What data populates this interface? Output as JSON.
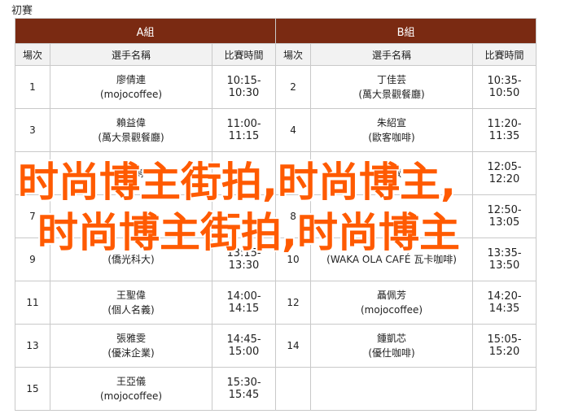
{
  "page_title": "初賽",
  "groups": {
    "a": "A組",
    "b": "B組"
  },
  "columns": {
    "seed": "場次",
    "player": "選手名稱",
    "time": "比賽時間"
  },
  "rows": [
    {
      "a": {
        "seed": "1",
        "name": "廖倩連",
        "team": "(mojocoffee)",
        "time": "10:15-10:30"
      },
      "b": {
        "seed": "2",
        "name": "丁佳芸",
        "team": "(萬大景觀餐廳)",
        "time": "10:35-10:50"
      }
    },
    {
      "a": {
        "seed": "3",
        "name": "賴益偉",
        "team": "(萬大景觀餐廳)",
        "time": "11:00-11:15"
      },
      "b": {
        "seed": "4",
        "name": "朱紹宣",
        "team": "(歐客咖啡)",
        "time": "11:20-11:35"
      }
    },
    {
      "a": {
        "seed": "5",
        "name": "許鈺婷",
        "team": "",
        "time": ""
      },
      "b": {
        "seed": "6",
        "name": "劉淑",
        "team": "",
        "time": "12:05-12:20"
      }
    },
    {
      "a": {
        "seed": "7",
        "name": "",
        "team": "",
        "time": ""
      },
      "b": {
        "seed": "8",
        "name": "",
        "team": "",
        "time": "12:50-13:05"
      }
    },
    {
      "a": {
        "seed": "9",
        "name": "",
        "team": "(僑光科大)",
        "time": "13:15-13:30"
      },
      "b": {
        "seed": "10",
        "name": "",
        "team": "(WAKA OLA CAFÉ 瓦卡咖啡)",
        "time": "13:35-13:50"
      }
    },
    {
      "a": {
        "seed": "11",
        "name": "王聖偉",
        "team": "(個人名義)",
        "time": "14:00-14:15"
      },
      "b": {
        "seed": "12",
        "name": "聶佩芳",
        "team": "(mojocoffee)",
        "time": "14:20-14:35"
      }
    },
    {
      "a": {
        "seed": "13",
        "name": "張雅雯",
        "team": "(優沫企業)",
        "time": "14:45-15:00"
      },
      "b": {
        "seed": "14",
        "name": "鍾凱芯",
        "team": "(優仕咖啡)",
        "time": "15:05-15:20"
      }
    },
    {
      "a": {
        "seed": "15",
        "name": "王亞儀",
        "team": "(mojocoffee)",
        "time": "15:30-15:45"
      },
      "b": {
        "seed": "",
        "name": "",
        "team": "",
        "time": ""
      }
    }
  ],
  "watermark": {
    "line1": "时尚博主街拍,时尚博主,",
    "line2": "时尚博主街拍,时尚博主"
  },
  "colors": {
    "header_bg": "#7a2a12",
    "subheader_bg": "#f2f2f2",
    "watermark": "#ff5a00"
  }
}
